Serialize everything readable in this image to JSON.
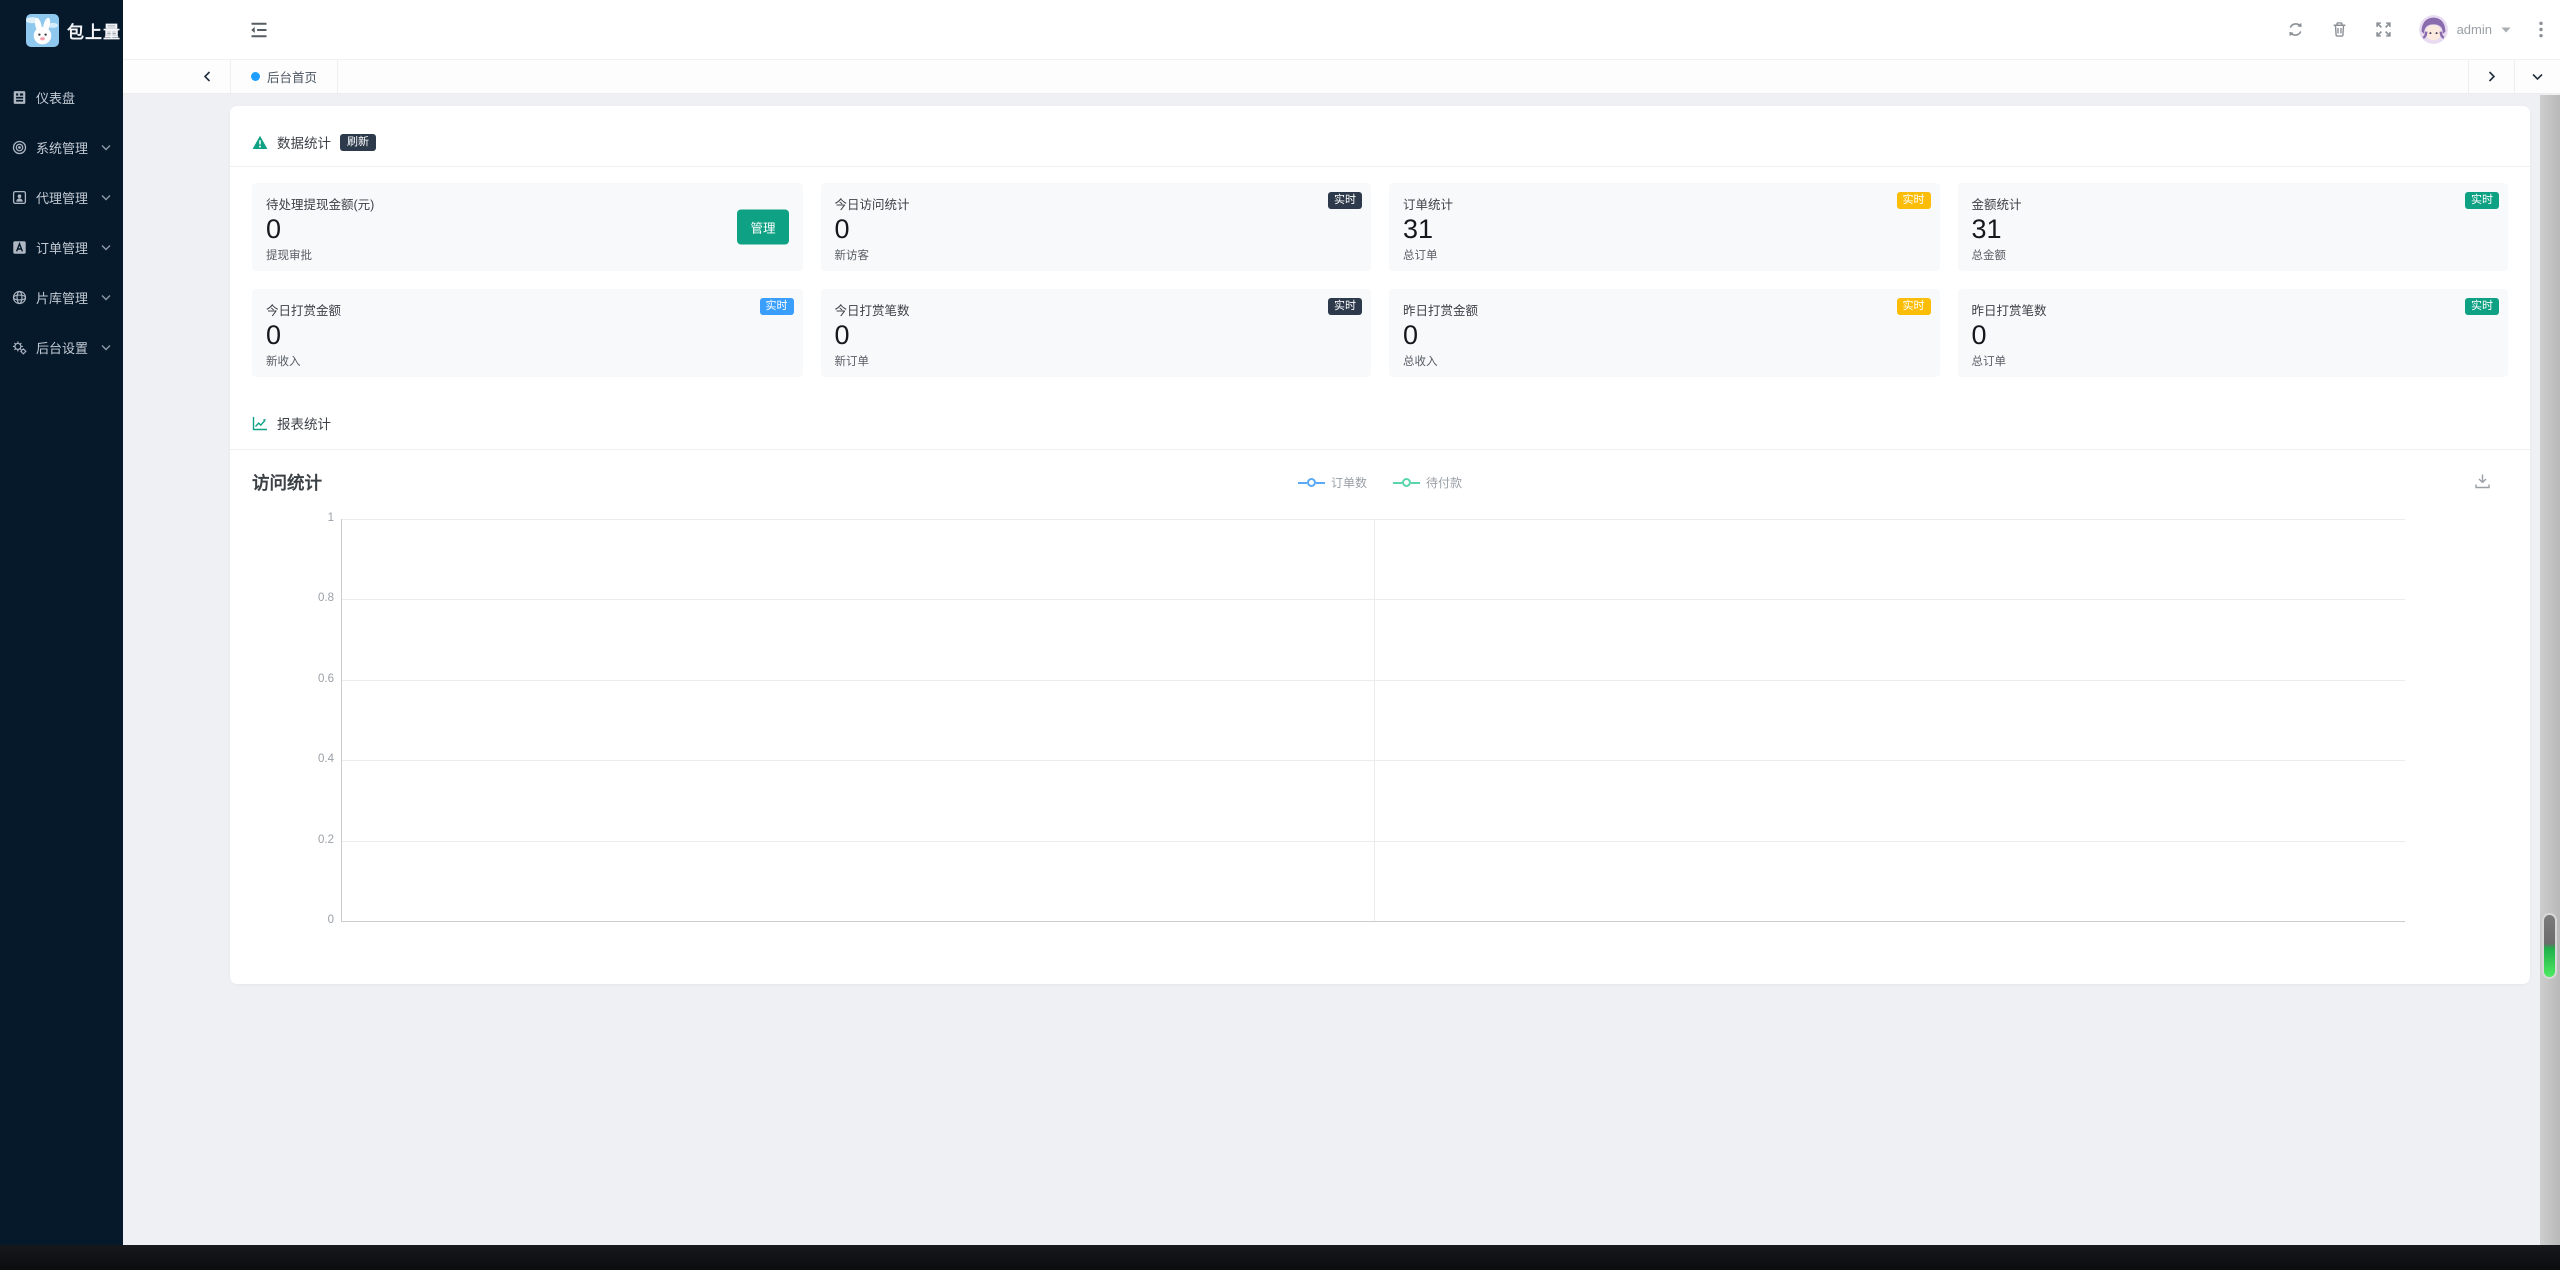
{
  "app": {
    "title": "包上量"
  },
  "sidebar": {
    "items": [
      {
        "label": "仪表盘",
        "icon": "dashboard-icon",
        "expandable": false
      },
      {
        "label": "系统管理",
        "icon": "system-icon",
        "expandable": true
      },
      {
        "label": "代理管理",
        "icon": "agent-icon",
        "expandable": true
      },
      {
        "label": "订单管理",
        "icon": "order-icon",
        "expandable": true
      },
      {
        "label": "片库管理",
        "icon": "library-icon",
        "expandable": true
      },
      {
        "label": "后台设置",
        "icon": "settings-icon",
        "expandable": true
      }
    ]
  },
  "topbar": {
    "username": "admin"
  },
  "tabs": {
    "items": [
      {
        "label": "后台首页",
        "active": true
      }
    ]
  },
  "stats": {
    "section_title": "数据统计",
    "refresh_badge": "刷新",
    "cards": [
      {
        "title": "待处理提现金额(元)",
        "value": "0",
        "sub": "提现审批",
        "action": "管理"
      },
      {
        "title": "今日访问统计",
        "value": "0",
        "sub": "新访客",
        "badge": "实时",
        "badge_color": "#2d3a4b"
      },
      {
        "title": "订单统计",
        "value": "31",
        "sub": "总订单",
        "badge": "实时",
        "badge_color": "#fbbd08"
      },
      {
        "title": "金额统计",
        "value": "31",
        "sub": "总金额",
        "badge": "实时",
        "badge_color": "#0fa183"
      },
      {
        "title": "今日打赏金额",
        "value": "0",
        "sub": "新收入",
        "badge": "实时",
        "badge_color": "#3a9ffc"
      },
      {
        "title": "今日打赏笔数",
        "value": "0",
        "sub": "新订单",
        "badge": "实时",
        "badge_color": "#2d3a4b"
      },
      {
        "title": "昨日打赏金额",
        "value": "0",
        "sub": "总收入",
        "badge": "实时",
        "badge_color": "#fbbd08"
      },
      {
        "title": "昨日打赏笔数",
        "value": "0",
        "sub": "总订单",
        "badge": "实时",
        "badge_color": "#0fa183"
      }
    ]
  },
  "report": {
    "section_title": "报表统计"
  },
  "chart_data": {
    "type": "line",
    "title": "访问统计",
    "x": [],
    "series": [
      {
        "name": "订单数",
        "color": "#59a9f7",
        "values": []
      },
      {
        "name": "待付款",
        "color": "#58d5ac",
        "values": []
      }
    ],
    "ylim": [
      0,
      1
    ],
    "yticks": [
      0,
      0.2,
      0.4,
      0.6,
      0.8,
      1
    ],
    "ytick_labels": [
      "1",
      "0.8",
      "0.6",
      "0.4",
      "0.2",
      "0"
    ],
    "grid": true,
    "legend_position": "top-center"
  },
  "colors": {
    "accent_teal": "#0fa183",
    "badge_dark": "#2d3a4b",
    "tab_dot": "#1e9fff",
    "sidebar_bg": "#06192b"
  }
}
